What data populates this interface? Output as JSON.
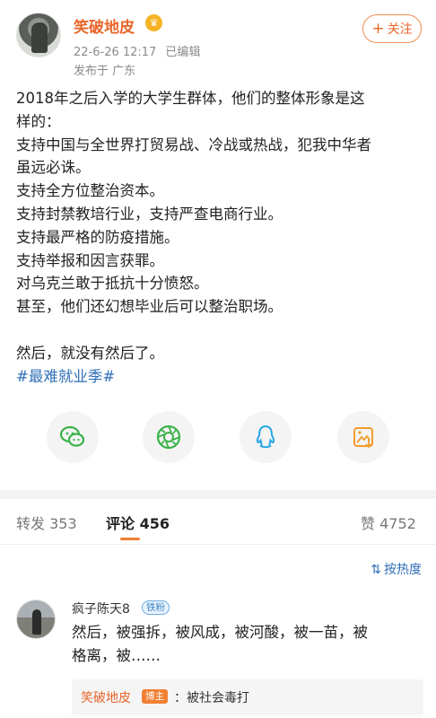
{
  "post": {
    "author": "笑破地皮",
    "date": "22-6-26 12:17",
    "edited": "已编辑",
    "location": "发布于 广东",
    "follow_label": "关注",
    "follow_plus": "+",
    "lines": [
      "2018年之后入学的大学生群体，他们的整体形象是这",
      "样的：",
      "支持中国与全世界打贸易战、冷战或热战，犯我中华者",
      "虽远必诛。",
      "支持全方位整治资本。",
      "支持封禁教培行业，支持严查电商行业。",
      "支持最严格的防疫措施。",
      "支持举报和因言获罪。",
      "对乌克兰敢于抵抗十分愤怒。",
      "甚至，他们还幻想毕业后可以整治职场。",
      "然后，就没有然后了。"
    ],
    "hashtag": "#最难就业季#"
  },
  "share": {
    "icons": [
      "wechat-icon",
      "moments-icon",
      "qq-icon",
      "save-image-icon"
    ]
  },
  "tabs": {
    "repost_label": "转发",
    "repost_count": "353",
    "comments_label": "评论",
    "comments_count": "456",
    "likes_label": "赞",
    "likes_count": "4752"
  },
  "sort": {
    "label": "按热度",
    "icon": "sort-icon"
  },
  "comments": [
    {
      "user": "疯子陈天8",
      "badge": "铁粉",
      "text_line1": "然后，被强拆，被风成，被河酸，被一苗，被",
      "text_line2": "格离，被……",
      "reply": {
        "author": "笑破地皮",
        "badge": "博主",
        "text": "：被社会毒打"
      }
    }
  ],
  "colors": {
    "accent": "#e8662b",
    "link": "#2e6fb7",
    "tab_indicator": "#f08033"
  }
}
